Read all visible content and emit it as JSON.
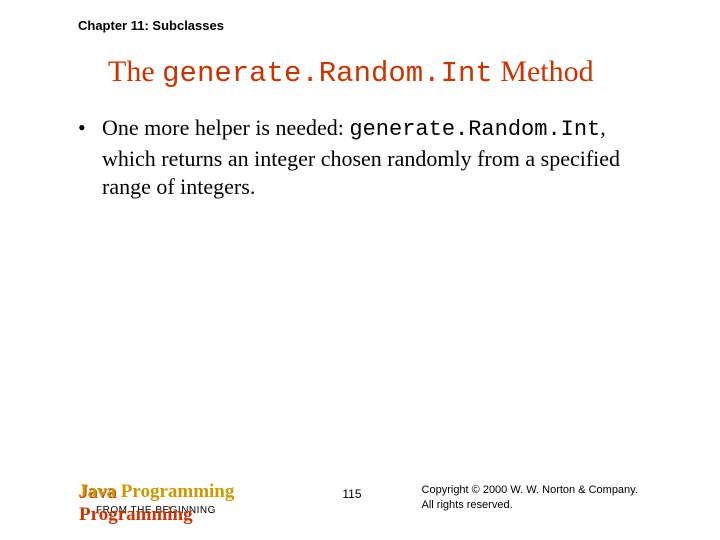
{
  "header": {
    "chapter": "Chapter 11: Subclasses"
  },
  "title": {
    "prefix": "The ",
    "code": "generate.Random.Int",
    "suffix": " Method"
  },
  "bullet": {
    "marker": "•",
    "part1": "One more helper is needed: ",
    "code": "generate.Random.Int",
    "part2": ", which returns an integer chosen randomly from a specified range of integers."
  },
  "footer": {
    "book_title": "Java Programming",
    "book_subtitle": "FROM THE BEGINNING",
    "page_number": "115",
    "copyright_line1": "Copyright © 2000 W. W. Norton & Company.",
    "copyright_line2": "All rights reserved."
  }
}
